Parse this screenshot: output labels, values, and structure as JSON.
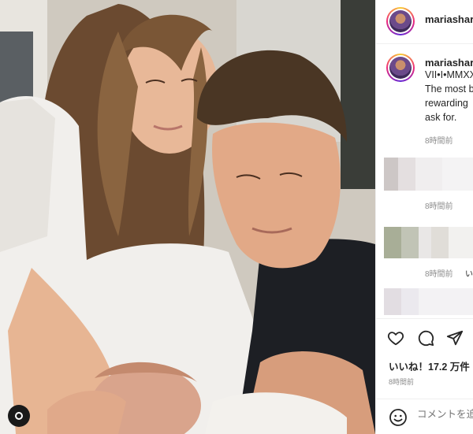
{
  "post": {
    "username": "mariashara",
    "caption_lines": [
      "VII•I•MMXX",
      "The most b",
      "rewarding",
      "ask for."
    ],
    "caption_time": "8時間前",
    "comments": [
      {
        "time": "8時間前"
      },
      {
        "time": "8時間前",
        "extra": "い"
      }
    ],
    "likes": "いいね！17.2 万件",
    "post_time": "8時間前",
    "comment_placeholder": "コメントを追"
  },
  "icons": {
    "like": "heart-icon",
    "comment": "comment-bubble-icon",
    "share": "paper-plane-icon",
    "emoji": "smiley-icon",
    "user_badge": "user-circle-icon"
  },
  "colors": {
    "text": "#262626",
    "muted": "#8e8e8e",
    "border": "#efefef",
    "story_ring": [
      "#f9ce34",
      "#ee2a7b",
      "#6228d7"
    ]
  }
}
